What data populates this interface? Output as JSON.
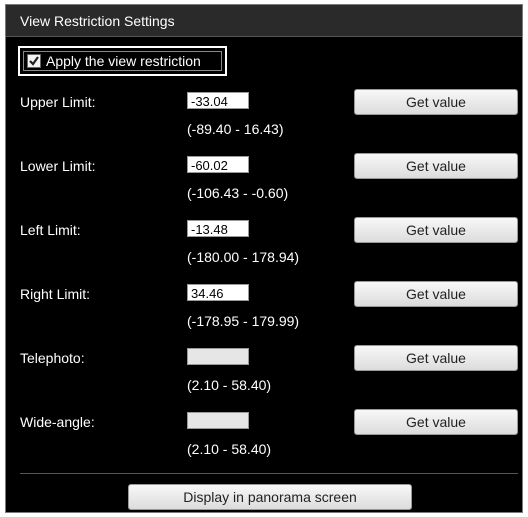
{
  "panel": {
    "title": "View Restriction Settings"
  },
  "apply": {
    "label": "Apply the view restriction",
    "checked": true
  },
  "rows": [
    {
      "label": "Upper Limit:",
      "value": "-33.04",
      "range": "(-89.40 - 16.43)",
      "button": "Get value"
    },
    {
      "label": "Lower Limit:",
      "value": "-60.02",
      "range": "(-106.43 - -0.60)",
      "button": "Get value"
    },
    {
      "label": "Left Limit:",
      "value": "-13.48",
      "range": "(-180.00 - 178.94)",
      "button": "Get value"
    },
    {
      "label": "Right Limit:",
      "value": "34.46",
      "range": "(-178.95 - 179.99)",
      "button": "Get value"
    },
    {
      "label": "Telephoto:",
      "value": "",
      "range": "(2.10 - 58.40)",
      "button": "Get value"
    },
    {
      "label": "Wide-angle:",
      "value": "",
      "range": "(2.10 - 58.40)",
      "button": "Get value"
    }
  ],
  "panorama": {
    "label": "Display in panorama screen"
  }
}
